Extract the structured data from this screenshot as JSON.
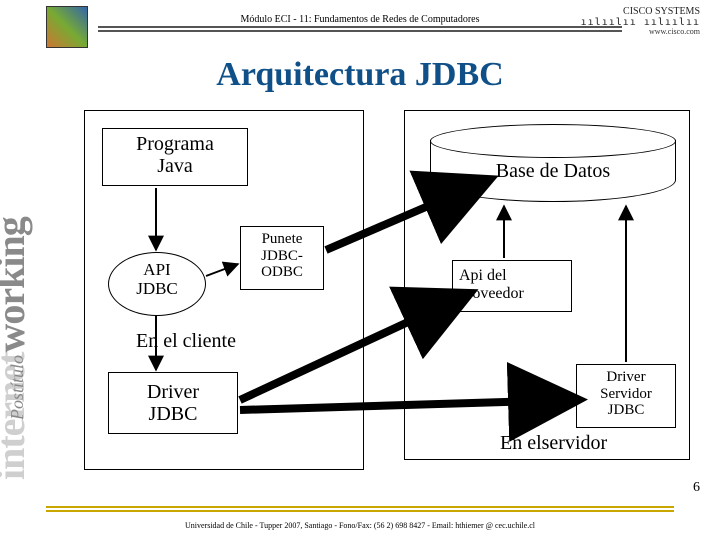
{
  "header": {
    "module": "Módulo ECI - 11: Fundamentos de Redes de Computadores",
    "cisco_top": "CISCO SYSTEMS",
    "cisco_url": "www.cisco.com"
  },
  "title": "Arquitectura JDBC",
  "side": {
    "postitulo": "Postítulo",
    "word_gray": "internet",
    "word_dark": "working"
  },
  "diagram": {
    "client_box_caption": "En el cliente",
    "server_box_caption": "En elservidor",
    "programa_java": "Programa\nJava",
    "api_jdbc": "API\nJDBC",
    "puente": "Punete\nJDBC-\nODBC",
    "driver_jdbc": "Driver\nJDBC",
    "base_datos": "Base de Datos",
    "api_proveedor": "Api del\nproveedor",
    "driver_servidor": "Driver\nServidor\nJDBC"
  },
  "footer": {
    "text": "Universidad de Chile - Tupper 2007, Santiago - Fono/Fax: (56 2) 698 8427 - Email: hthiemer @ cec.uchile.cl",
    "page": "6"
  }
}
